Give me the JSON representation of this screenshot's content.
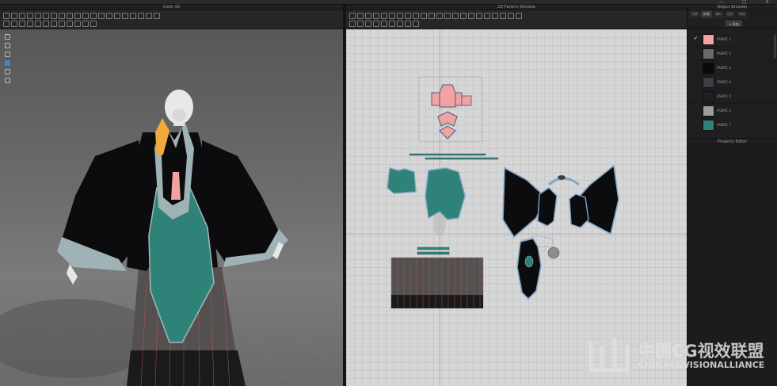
{
  "window": {
    "controls": [
      "—",
      "□",
      "✕"
    ]
  },
  "panels": {
    "cloth_3d": {
      "title": "Cloth 3D"
    },
    "pattern_2d": {
      "title": "2D Pattern Window"
    },
    "object_browser": {
      "title": "Object Browser",
      "tabs": [
        "场景",
        "织物",
        "辅料",
        "纽扣",
        "明线"
      ],
      "active_tab": 1,
      "add_button": "+ 添加",
      "fabrics": [
        {
          "name": "FABRIC 1",
          "color": "#f0a3a0",
          "selected": true
        },
        {
          "name": "FABRIC 2",
          "color": "#6a6a6a",
          "selected": false
        },
        {
          "name": "FABRIC 3",
          "color": "#0a0a0a",
          "selected": false
        },
        {
          "name": "FABRIC 4",
          "color": "#3e3e44",
          "selected": false
        },
        {
          "name": "FABRIC 5",
          "color": "#1f1f21",
          "selected": false
        },
        {
          "name": "FABRIC 6",
          "color": "#9c9c9c",
          "selected": false
        },
        {
          "name": "FABRIC 7",
          "color": "#2f8278",
          "selected": false
        }
      ]
    },
    "property_editor": {
      "title": "Property Editor"
    }
  },
  "colors": {
    "pink": "#f0a3a0",
    "teal": "#2f8278",
    "black": "#0c0c0e",
    "trim": "#9fb3b6",
    "skirt": "#565252"
  },
  "watermark": {
    "line1": "中国CG视效联盟",
    "line2": "CHINACGVISIONALLIANCE"
  }
}
